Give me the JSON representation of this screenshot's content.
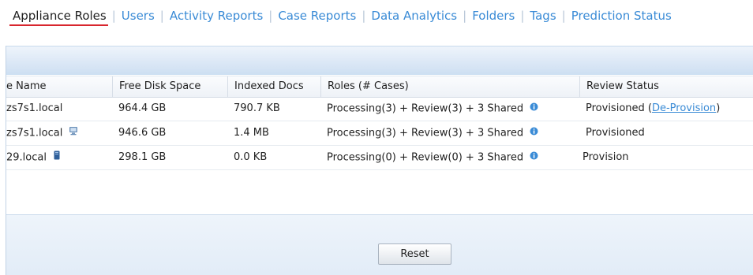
{
  "tabs": [
    {
      "label": "Appliance Roles",
      "active": true
    },
    {
      "label": "Users",
      "active": false
    },
    {
      "label": "Activity Reports",
      "active": false
    },
    {
      "label": "Case Reports",
      "active": false
    },
    {
      "label": "Data Analytics",
      "active": false
    },
    {
      "label": "Folders",
      "active": false
    },
    {
      "label": "Tags",
      "active": false
    },
    {
      "label": "Prediction Status",
      "active": false
    }
  ],
  "separator": "|",
  "table": {
    "columns": [
      "e Name",
      "Free Disk Space",
      "Indexed Docs",
      "Roles (# Cases)",
      "Review Status"
    ],
    "rows": [
      {
        "name": "zs7s1.local",
        "name_icon": "",
        "disk": "964.4 GB",
        "docs": "790.7 KB",
        "roles": "Processing(3) + Review(3) + 3 Shared",
        "status": "Provisioned (",
        "status_link": "De-Provision",
        "status_tail": ")"
      },
      {
        "name": "zs7s1.local",
        "name_icon": "computer-icon",
        "disk": "946.6 GB",
        "docs": "1.4 MB",
        "roles": "Processing(3) + Review(3) + 3 Shared",
        "status": "Provisioned",
        "status_link": "",
        "status_tail": ""
      },
      {
        "name": "29.local",
        "name_icon": "server-icon",
        "disk": "298.1 GB",
        "docs": "0.0 KB",
        "roles": "Processing(0) + Review(0) + 3 Shared",
        "status": "Provision",
        "status_link": "",
        "status_tail": ""
      }
    ]
  },
  "reset_label": "Reset",
  "colors": {
    "accent": "#3a8bd6",
    "active_underline": "#d8262e",
    "panel_blue": "#dce8f6"
  }
}
